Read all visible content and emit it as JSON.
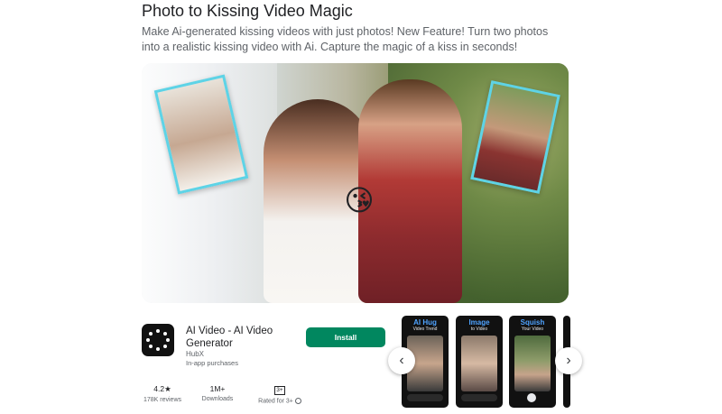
{
  "promo": {
    "headline": "Photo to Kissing Video Magic",
    "description": "Make Ai-generated kissing videos with just photos! New Feature! Turn two photos into a realistic kissing video with Ai. Capture the magic of a kiss in seconds!",
    "hero_emoji": "😘"
  },
  "app": {
    "name": "AI Video - AI Video Generator",
    "developer": "HubX",
    "in_app": "In-app purchases",
    "install_label": "Install",
    "install_color": "#01875f"
  },
  "stats": {
    "rating_value": "4.2★",
    "rating_label": "178K reviews",
    "downloads_value": "1M+",
    "downloads_label": "Downloads",
    "content_rating_badge": "3+",
    "content_rating_label": "Rated for 3+"
  },
  "screenshots": [
    {
      "title": "AI Hug",
      "subtitle": "Video Trend"
    },
    {
      "title": "Image",
      "subtitle": "to Video"
    },
    {
      "title": "Squish",
      "subtitle": "Your Video"
    }
  ],
  "nav": {
    "prev_icon": "‹",
    "next_icon": "›"
  }
}
